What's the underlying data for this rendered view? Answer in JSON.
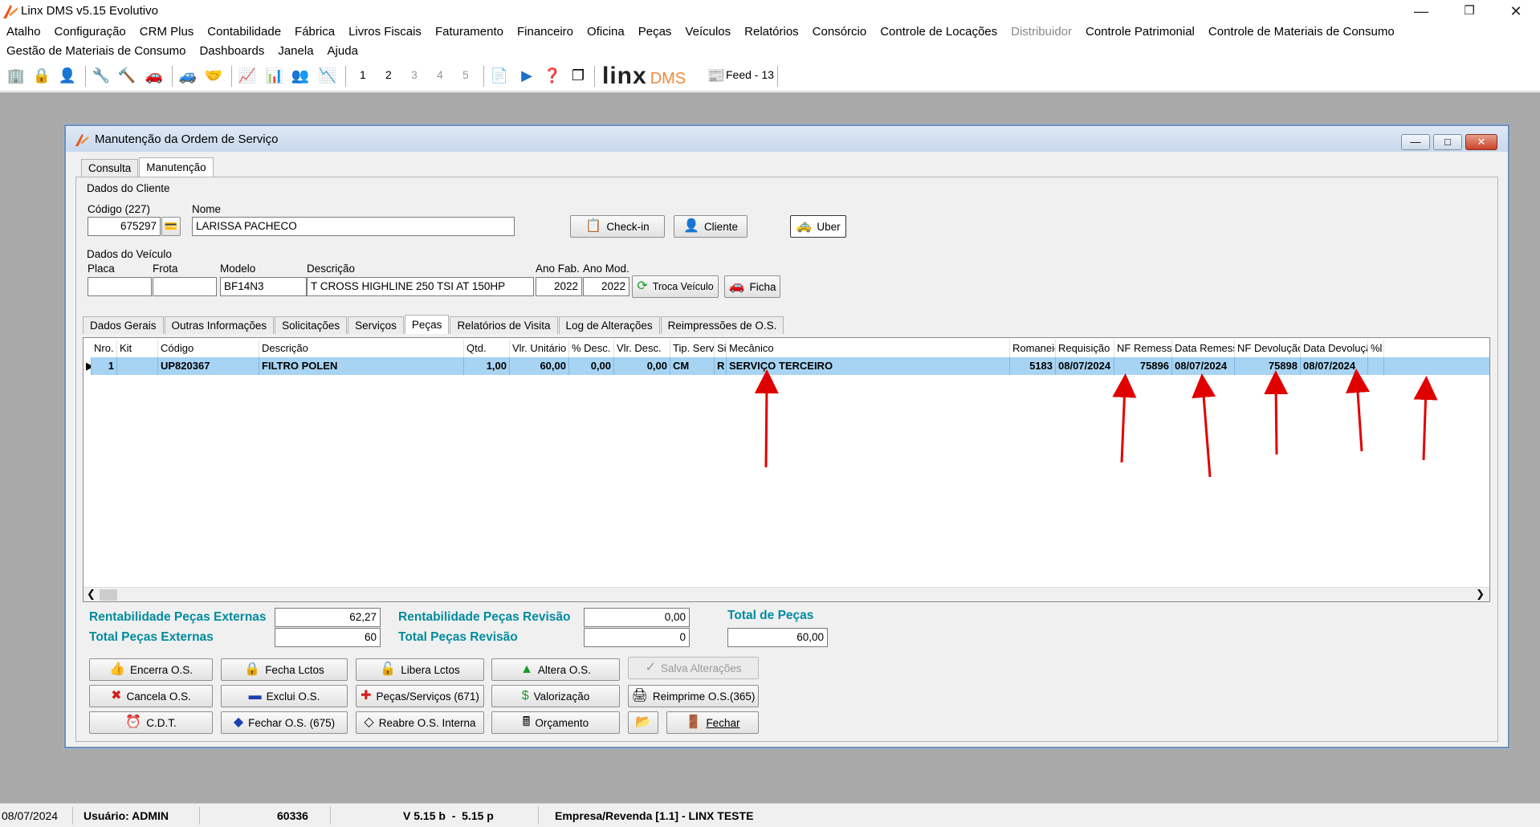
{
  "app": {
    "title": "Linx DMS v5.15 Evolutivo",
    "menu_row1": [
      "Atalho",
      "Configuração",
      "CRM Plus",
      "Contabilidade",
      "Fábrica",
      "Livros Fiscais",
      "Faturamento",
      "Financeiro",
      "Oficina",
      "Peças",
      "Veículos",
      "Relatórios",
      "Consórcio",
      "Controle de Locações",
      "Distribuidor",
      "Controle Patrimonial",
      "Controle de Materiais de Consumo"
    ],
    "menu_row1_disabled": "Distribuidor",
    "menu_row2": [
      "Gestão de Materiais de Consumo",
      "Dashboards",
      "Janela",
      "Ajuda"
    ],
    "toolbar_numbers": [
      "1",
      "2",
      "3",
      "4",
      "5"
    ],
    "brand_logo": "LINX",
    "brand_dms": "DMS",
    "feed_label": "Feed - 13"
  },
  "window": {
    "title": "Manutenção da Ordem de Serviço",
    "tabs": [
      "Consulta",
      "Manutenção"
    ],
    "active_tab": "Manutenção"
  },
  "cliente": {
    "group_label": "Dados do Cliente",
    "codigo_label": "Código (227)",
    "codigo": "675297",
    "nome_label": "Nome",
    "nome": "LARISSA PACHECO",
    "btn_checkin": "Check-in",
    "btn_cliente": "Cliente",
    "btn_uber": "Uber"
  },
  "veiculo": {
    "group_label": "Dados do Veículo",
    "placa_label": "Placa",
    "placa": "",
    "frota_label": "Frota",
    "frota": "",
    "modelo_label": "Modelo",
    "modelo": "BF14N3",
    "descricao_label": "Descrição",
    "descricao": "T CROSS HIGHLINE 250 TSI AT 150HP",
    "ano_fab_label": "Ano Fab.",
    "ano_fab": "2022",
    "ano_mod_label": "Ano Mod.",
    "ano_mod": "2022",
    "btn_troca": "Troca Veículo",
    "btn_ficha": "Ficha"
  },
  "subtabs": [
    "Dados Gerais",
    "Outras Informações",
    "Solicitações",
    "Serviços",
    "Peças",
    "Relatórios de Visita",
    "Log de Alterações",
    "Reimpressões de O.S."
  ],
  "active_subtab": "Peças",
  "grid": {
    "columns": [
      "Nro.",
      "Kit",
      "Código",
      "Descrição",
      "Qtd.",
      "Vlr. Unitário",
      "% Desc.",
      "Vlr. Desc.",
      "Tip. Serv.",
      "Sit.",
      "Mecânico",
      "Romaneio",
      "Requisição",
      "NF Remessa",
      "Data Remessa",
      "NF Devolução",
      "Data Devolução",
      "%l"
    ],
    "rows": [
      [
        "1",
        "",
        "UP820367",
        "FILTRO POLEN",
        "1,00",
        "60,00",
        "0,00",
        "0,00",
        "CM",
        "R",
        "SERVIÇO TERCEIRO",
        "5183",
        "08/07/2024",
        "75896",
        "08/07/2024",
        "75898",
        "08/07/2024",
        ""
      ]
    ]
  },
  "totals": {
    "rent_ext_label": "Rentabilidade Peças Externas",
    "rent_ext": "62,27",
    "total_ext_label": "Total Peças Externas",
    "total_ext": "60",
    "rent_rev_label": "Rentabilidade Peças Revisão",
    "rent_rev": "0,00",
    "total_rev_label": "Total Peças Revisão",
    "total_rev": "0",
    "total_pecas_label": "Total de Peças",
    "total_pecas": "60,00"
  },
  "actions": {
    "encerra": "Encerra O.S.",
    "fecha_lctos": "Fecha Lctos",
    "libera_lctos": "Libera Lctos",
    "altera": "Altera O.S.",
    "salva": "Salva Alterações",
    "cancela": "Cancela O.S.",
    "exclui": "Exclui O.S.",
    "pecas_servicos": "Peças/Serviços (671)",
    "valorizacao": "Valorização",
    "reimprime": "Reimprime O.S.(365)",
    "cdt": "C.D.T.",
    "fechar_os": "Fechar O.S. (675)",
    "reabre": "Reabre O.S. Interna",
    "orcamento": "Orçamento",
    "fechar": "Fechar"
  },
  "status": {
    "date": "08/07/2024",
    "user": "Usuário: ADMIN",
    "code": "60336",
    "version": "V 5.15 b  -  5.15 p",
    "empresa": "Empresa/Revenda [1.1] - LINX TESTE"
  },
  "colors": {
    "selected_row": "#a8d4f3",
    "totals_label": "#008b9e",
    "annotation_arrow": "#e00000"
  }
}
